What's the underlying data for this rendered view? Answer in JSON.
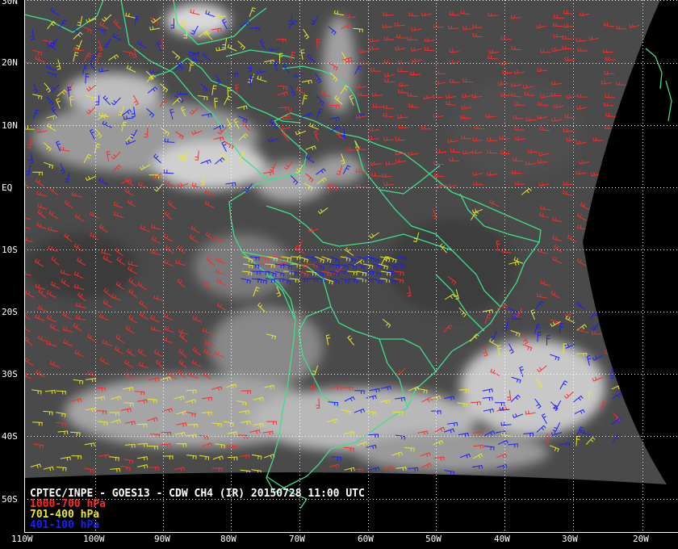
{
  "caption": "CPTEC/INPE - GOES13 - CDW CH4 (IR) 20150728 11:00 UTC",
  "legend": [
    {
      "label": "1000-700 hPa",
      "color": "#ff2a2a"
    },
    {
      "label": "701-400 hPa",
      "color": "#e8e82a"
    },
    {
      "label": "401-100 hPa",
      "color": "#1c1cff"
    }
  ],
  "lat_labels": [
    "30N",
    "20N",
    "10N",
    "EQ",
    "10S",
    "20S",
    "30S",
    "40S",
    "50S"
  ],
  "lon_labels": [
    "110W",
    "100W",
    "90W",
    "80W",
    "70W",
    "60W",
    "50W",
    "40W",
    "30W",
    "20W"
  ],
  "colors": {
    "coast": "#3ee08a",
    "grid": "#ffffff",
    "background": "#000000"
  }
}
